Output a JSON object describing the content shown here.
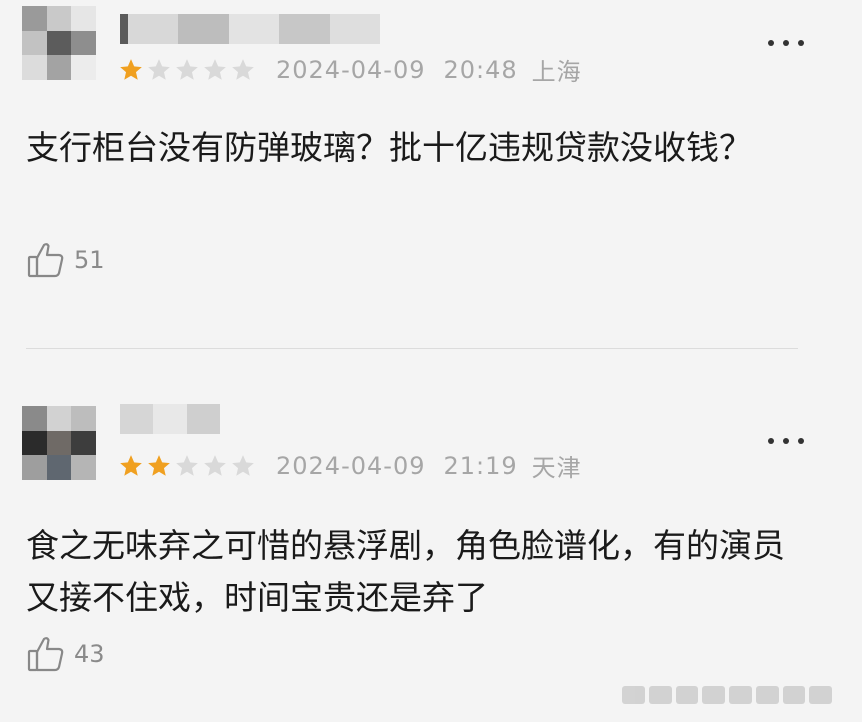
{
  "reviews": [
    {
      "rating": 1,
      "max_rating": 5,
      "date": "2024-04-09",
      "time": "20:48",
      "location": "上海",
      "content": "支行柜台没有防弹玻璃？批十亿违规贷款没收钱？",
      "likes": "51"
    },
    {
      "rating": 2,
      "max_rating": 5,
      "date": "2024-04-09",
      "time": "21:19",
      "location": "天津",
      "content": "食之无味弃之可惜的悬浮剧，角色脸谱化，有的演员又接不住戏，时间宝贵还是弃了",
      "likes": "43"
    }
  ],
  "colors": {
    "star_filled": "#f0a020",
    "star_empty": "#d9d9d9",
    "meta_text": "#a6a6a6",
    "body_text": "#1a1a1a"
  },
  "icons": {
    "like": "thumbs-up-icon",
    "more": "more-dots-icon",
    "star": "star-icon"
  }
}
